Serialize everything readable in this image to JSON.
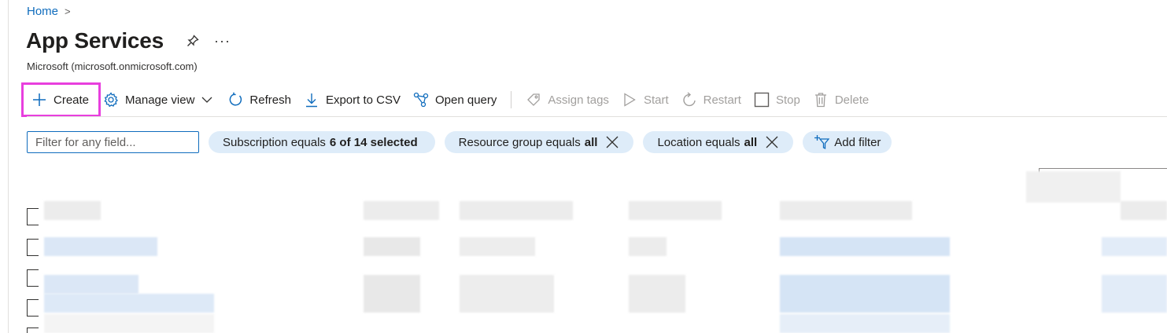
{
  "breadcrumb": {
    "home_label": "Home",
    "separator": ">"
  },
  "header": {
    "title": "App Services",
    "subtitle": "Microsoft (microsoft.onmicrosoft.com)",
    "more_label": "···",
    "pin_icon": "pin-icon"
  },
  "toolbar": {
    "create_label": "Create",
    "manage_view_label": "Manage view",
    "refresh_label": "Refresh",
    "export_label": "Export to CSV",
    "open_query_label": "Open query",
    "assign_tags_label": "Assign tags",
    "start_label": "Start",
    "restart_label": "Restart",
    "stop_label": "Stop",
    "delete_label": "Delete"
  },
  "filters": {
    "search_placeholder": "Filter for any field...",
    "search_value": "",
    "subscription_prefix": "Subscription equals",
    "subscription_value": "6 of 14 selected",
    "resource_group_prefix": "Resource group equals",
    "resource_group_value": "all",
    "location_prefix": "Location equals",
    "location_value": "all",
    "add_filter_label": "Add filter"
  },
  "colors": {
    "accent": "#0f6cbd",
    "pill_bg": "#deecf9",
    "highlight": "#e83fde",
    "disabled": "#a19f9d"
  }
}
